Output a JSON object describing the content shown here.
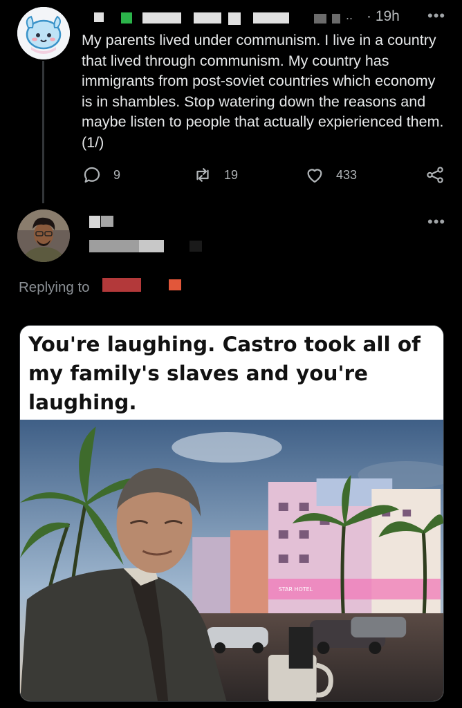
{
  "post": {
    "time": "· 19h",
    "more": "•••",
    "text": "My parents lived under communism. I live in a country that lived through communism. My country has immigrants from post-soviet countries which economy is in shambles. Stop watering down the reasons and maybe listen to people that actually expierienced them. (1/)",
    "replies": "9",
    "retweets": "19",
    "likes": "433",
    "handle_fragment": ".."
  },
  "reply": {
    "more": "•••",
    "replying_label": "Replying to",
    "meme_caption": "You're laughing. Castro took all of my family's slaves and you're laughing.",
    "hotel_sign": "STAR   HOTEL"
  },
  "icons": {
    "reply": "comment-icon",
    "retweet": "retweet-icon",
    "like": "heart-icon",
    "share": "share-icon"
  },
  "colors": {
    "background": "#000000",
    "text": "#e7e9ea",
    "muted": "#8b9095",
    "redaction_green": "#2bb34a",
    "redaction_orange": "#e2573a"
  }
}
